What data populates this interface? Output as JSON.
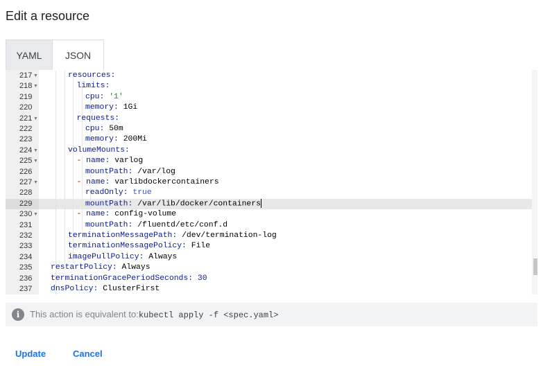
{
  "page": {
    "title": "Edit a resource"
  },
  "tabs": [
    {
      "label": "YAML",
      "selected": false
    },
    {
      "label": "JSON",
      "selected": true
    }
  ],
  "editor": {
    "active_line": 229,
    "lines": [
      {
        "n": "217",
        "fold": true,
        "indent": 4,
        "parts": [
          [
            "key",
            "resources:"
          ]
        ]
      },
      {
        "n": "218",
        "fold": true,
        "indent": 5,
        "parts": [
          [
            "key",
            "limits:"
          ]
        ]
      },
      {
        "n": "219",
        "fold": false,
        "indent": 6,
        "parts": [
          [
            "key",
            "cpu: "
          ],
          [
            "strv",
            "'1'"
          ]
        ]
      },
      {
        "n": "220",
        "fold": false,
        "indent": 6,
        "parts": [
          [
            "key",
            "memory: "
          ],
          [
            "plain",
            "1Gi"
          ]
        ]
      },
      {
        "n": "221",
        "fold": true,
        "indent": 5,
        "parts": [
          [
            "key",
            "requests:"
          ]
        ]
      },
      {
        "n": "222",
        "fold": false,
        "indent": 6,
        "parts": [
          [
            "key",
            "cpu: "
          ],
          [
            "plain",
            "50m"
          ]
        ]
      },
      {
        "n": "223",
        "fold": false,
        "indent": 6,
        "parts": [
          [
            "key",
            "memory: "
          ],
          [
            "plain",
            "200Mi"
          ]
        ]
      },
      {
        "n": "224",
        "fold": true,
        "indent": 4,
        "parts": [
          [
            "key",
            "volumeMounts:"
          ]
        ]
      },
      {
        "n": "225",
        "fold": true,
        "indent": 5,
        "parts": [
          [
            "dash",
            "- "
          ],
          [
            "key",
            "name: "
          ],
          [
            "plain",
            "varlog"
          ]
        ]
      },
      {
        "n": "226",
        "fold": false,
        "indent": 6,
        "parts": [
          [
            "key",
            "mountPath: "
          ],
          [
            "plain",
            "/var/log"
          ]
        ]
      },
      {
        "n": "227",
        "fold": true,
        "indent": 5,
        "parts": [
          [
            "dash",
            "- "
          ],
          [
            "key",
            "name: "
          ],
          [
            "plain",
            "varlibdockercontainers"
          ]
        ]
      },
      {
        "n": "228",
        "fold": false,
        "indent": 6,
        "parts": [
          [
            "key",
            "readOnly: "
          ],
          [
            "boolv",
            "true"
          ]
        ]
      },
      {
        "n": "229",
        "fold": false,
        "indent": 6,
        "parts": [
          [
            "key",
            "mountPath: "
          ],
          [
            "plain",
            "/var/lib/docker/containers"
          ]
        ]
      },
      {
        "n": "230",
        "fold": true,
        "indent": 5,
        "parts": [
          [
            "dash",
            "- "
          ],
          [
            "key",
            "name: "
          ],
          [
            "plain",
            "config-volume"
          ]
        ]
      },
      {
        "n": "231",
        "fold": false,
        "indent": 6,
        "parts": [
          [
            "key",
            "mountPath: "
          ],
          [
            "plain",
            "/fluentd/etc/conf.d"
          ]
        ]
      },
      {
        "n": "232",
        "fold": false,
        "indent": 4,
        "parts": [
          [
            "key",
            "terminationMessagePath: "
          ],
          [
            "plain",
            "/dev/termination-log"
          ]
        ]
      },
      {
        "n": "233",
        "fold": false,
        "indent": 4,
        "parts": [
          [
            "key",
            "terminationMessagePolicy: "
          ],
          [
            "plain",
            "File"
          ]
        ]
      },
      {
        "n": "234",
        "fold": false,
        "indent": 4,
        "parts": [
          [
            "key",
            "imagePullPolicy: "
          ],
          [
            "plain",
            "Always"
          ]
        ]
      },
      {
        "n": "235",
        "fold": false,
        "indent": 2,
        "parts": [
          [
            "key",
            "restartPolicy: "
          ],
          [
            "plain",
            "Always"
          ]
        ]
      },
      {
        "n": "236",
        "fold": false,
        "indent": 2,
        "parts": [
          [
            "key",
            "terminationGracePeriodSeconds: "
          ],
          [
            "num",
            "30"
          ]
        ]
      },
      {
        "n": "237",
        "fold": false,
        "indent": 2,
        "parts": [
          [
            "key",
            "dnsPolicy: "
          ],
          [
            "plain",
            "ClusterFirst"
          ]
        ]
      }
    ]
  },
  "info": {
    "icon": "info-icon",
    "text": "This action is equivalent to:",
    "command": "kubectl apply -f <spec.yaml>"
  },
  "actions": {
    "update_label": "Update",
    "cancel_label": "Cancel"
  },
  "colors": {
    "accent": "#1a73e8",
    "yaml_key": "#0b1a8f",
    "yaml_string": "#2e7d32",
    "yaml_dash": "#b00000"
  }
}
